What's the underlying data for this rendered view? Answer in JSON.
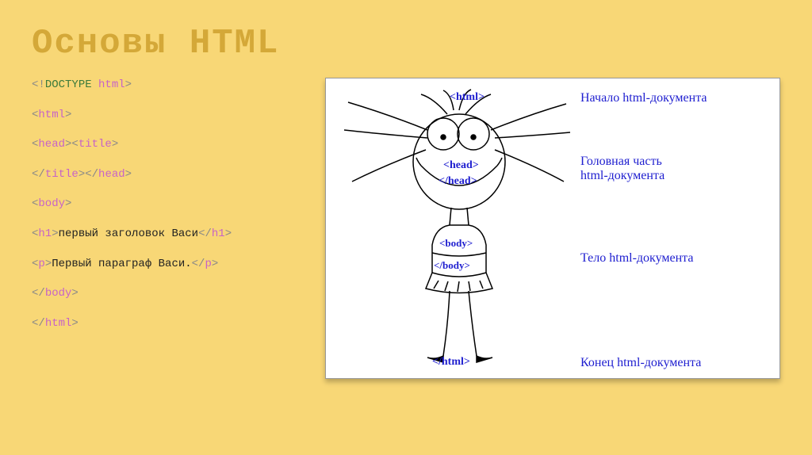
{
  "title": "Основы HTML",
  "code": {
    "line1": {
      "open": "<!",
      "doctype": "DOCTYPE",
      "sp": " ",
      "html": "html",
      "close": ">"
    },
    "line2": {
      "open": "<",
      "tag": "html",
      "close": ">"
    },
    "line3": {
      "open1": "<",
      "tag1": "head",
      "close1": "><",
      "tag2": "title",
      "close2": ">"
    },
    "line4": {
      "open1": "</",
      "tag1": "title",
      "close1": "></",
      "tag2": "head",
      "close2": ">"
    },
    "line5": {
      "open": "<",
      "tag": "body",
      "close": ">"
    },
    "line6": {
      "open": "<",
      "tag": "h1",
      "close": ">",
      "text": "первый заголовок Васи",
      "copen": "</",
      "ctag": "h1",
      "cclose": ">"
    },
    "line7": {
      "open": "<",
      "tag": "p",
      "close": ">",
      "text": "Первый параграф Васи.",
      "copen": "</",
      "ctag": "p",
      "cclose": ">"
    },
    "line8": {
      "open": "</",
      "tag": "body",
      "close": ">"
    },
    "line9": {
      "open": "</",
      "tag": "html",
      "close": ">"
    }
  },
  "diagram": {
    "tags": {
      "html_open": "<html>",
      "head_open": "<head>",
      "head_close": "</head>",
      "body_open": "<body>",
      "body_close": "</body>",
      "html_close": "</html>"
    },
    "labels": {
      "l1": "Начало html-документа",
      "l2": "Головная часть\nhtml-документа",
      "l3": "Тело html-документа",
      "l4": "Конец html-документа"
    }
  }
}
